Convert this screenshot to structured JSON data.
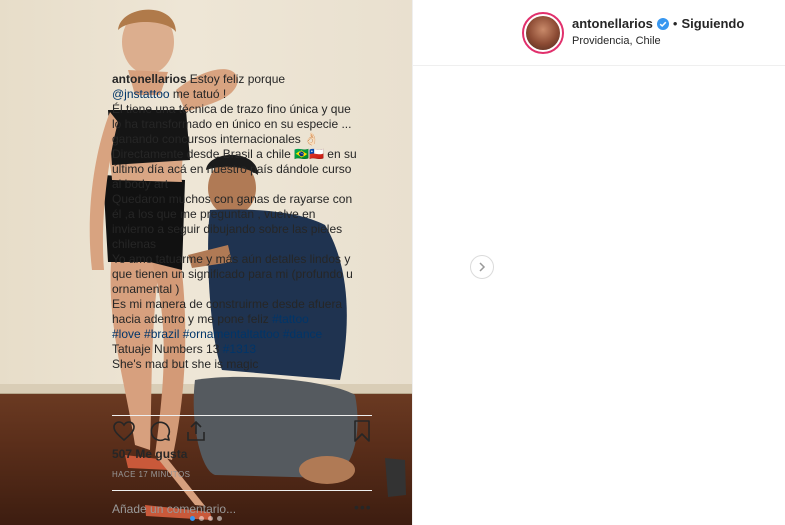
{
  "post": {
    "image_alt": "Woman in black top and shorts posing next to man kneeling and pointing at her leg tattoo",
    "carousel": {
      "count": 4,
      "active_index": 0
    }
  },
  "header": {
    "username": "antonellarios",
    "separator": "•",
    "follow_status": "Siguiendo",
    "location": "Providencia, Chile"
  },
  "caption": {
    "username": "antonellarios",
    "lines": [
      [
        {
          "t": "Estoy feliz porque"
        }
      ],
      [
        {
          "t": "@jnstattoo",
          "link": true
        },
        {
          "t": " me tatuó !"
        }
      ],
      [
        {
          "t": "Él tiene una técnica de trazo fino única y que lo ha transformado en único en su especie ... ganando concursos internacionales 👌🏻"
        }
      ],
      [
        {
          "t": "Directamente desde Brasil a chile 🇧🇷🇨🇱 en su último día acá en nuestro país dándole curso al body art"
        }
      ],
      [
        {
          "t": "Quedaron muchos con ganas de rayarse con él ,a los que me preguntan , vuelve en invierno a seguir dibujando sobre las pieles chilenas"
        }
      ],
      [
        {
          "t": "Yo amo tatuarme y más aún detalles lindos y que tienen un significado para mi (profundo u ornamental )"
        }
      ],
      [
        {
          "t": "Es mi manera de construirme desde afuera hacia adentro y me pone feliz "
        },
        {
          "t": "#tattoo",
          "link": true
        }
      ],
      [
        {
          "t": "#love",
          "link": true
        },
        {
          "t": " "
        },
        {
          "t": "#brazil",
          "link": true
        },
        {
          "t": " "
        },
        {
          "t": "#ornamentaltattoo",
          "link": true
        },
        {
          "t": " "
        },
        {
          "t": "#dance",
          "link": true
        }
      ],
      [
        {
          "t": "Tatuaje Numbers 13 "
        },
        {
          "t": "#1313",
          "link": true
        }
      ],
      [
        {
          "t": "She's mad but she is magic"
        }
      ]
    ]
  },
  "stats": {
    "likes": "507 Me gusta",
    "time_ago": "HACE 17 MINUTOS"
  },
  "comment": {
    "placeholder": "Añade un comentario...",
    "more": "•••"
  },
  "colors": {
    "link": "#003569",
    "verified": "#3897f0",
    "border": "#efefef",
    "muted": "#999999"
  }
}
